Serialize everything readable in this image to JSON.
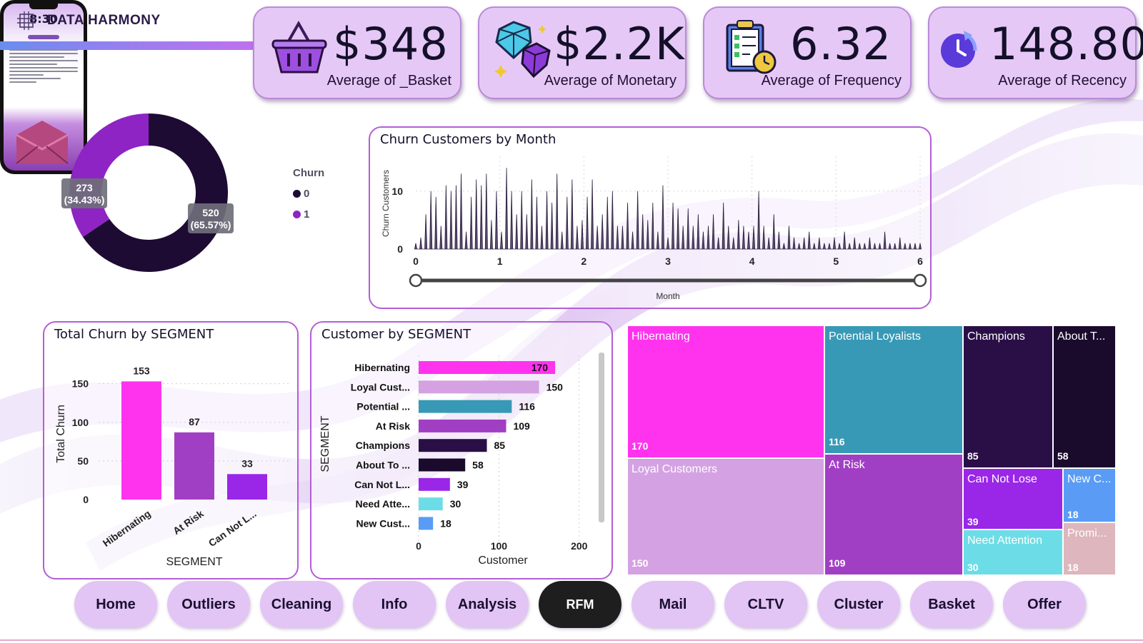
{
  "brand": {
    "name": "DATA HARMONY"
  },
  "kpis": [
    {
      "value": "$348",
      "label": "Average of _Basket",
      "icon": "basket-icon"
    },
    {
      "value": "$2.2K",
      "label": "Average of Monetary",
      "icon": "diamond-icon"
    },
    {
      "value": "6.32",
      "label": "Average of Frequency",
      "icon": "clipboard-clock-icon"
    },
    {
      "value": "148.80",
      "label": "Average of Recency",
      "icon": "refresh-clock-icon"
    }
  ],
  "donut": {
    "legend_title": "Churn",
    "slices": [
      {
        "name": "0",
        "value": 520,
        "label_count": "520",
        "label_pct": "(65.57%)",
        "color": "#1e0b33"
      },
      {
        "name": "1",
        "value": 273,
        "label_count": "273",
        "label_pct": "(34.43%)",
        "color": "#8e24c4"
      }
    ]
  },
  "churn_month": {
    "title": "Churn Customers by Month",
    "ylabel": "Churn Customers",
    "xlabel": "Month",
    "y_ticks": [
      "0",
      "10"
    ],
    "x_ticks": [
      "0",
      "1",
      "2",
      "3",
      "4",
      "5",
      "6"
    ],
    "slider_range": [
      0,
      6
    ]
  },
  "phone": {
    "time": "8:30"
  },
  "churn_segment": {
    "title": "Total Churn by SEGMENT",
    "ylabel": "Total Churn",
    "xlabel": "SEGMENT",
    "y_ticks": [
      "0",
      "50",
      "100",
      "150"
    ]
  },
  "customer_segment": {
    "title": "Customer by SEGMENT",
    "ylabel": "SEGMENT",
    "xlabel": "Customer",
    "x_ticks": [
      "0",
      "100",
      "200"
    ]
  },
  "treemap": {
    "cells": [
      {
        "name": "Hibernating",
        "value": "170",
        "color": "#ff33ee"
      },
      {
        "name": "Potential Loyalists",
        "value": "116",
        "color": "#3799b5"
      },
      {
        "name": "Champions",
        "value": "85",
        "color": "#2a0f47"
      },
      {
        "name": "About T...",
        "value": "58",
        "color": "#1a0a2c"
      },
      {
        "name": "Loyal Customers",
        "value": "150",
        "color": "#d4a2e2"
      },
      {
        "name": "At Risk",
        "value": "109",
        "color": "#a13fc4"
      },
      {
        "name": "Can Not Lose",
        "value": "39",
        "color": "#9a26e8"
      },
      {
        "name": "New C...",
        "value": "18",
        "color": "#5a9cf5"
      },
      {
        "name": "Need Attention",
        "value": "30",
        "color": "#6cdde6"
      },
      {
        "name": "Promi...",
        "value": "18",
        "color": "#deb6bd"
      }
    ]
  },
  "chart_data": [
    {
      "type": "pie",
      "title": "",
      "categories": [
        "0",
        "1"
      ],
      "values": [
        520,
        273
      ],
      "percentages": [
        65.57,
        34.43
      ],
      "legend": "right",
      "legend_title": "Churn"
    },
    {
      "type": "area",
      "title": "Churn Customers by Month",
      "xlabel": "Month",
      "ylabel": "Churn Customers",
      "xlim": [
        0,
        6
      ],
      "ylim": [
        0,
        16
      ],
      "x": [
        0.0,
        0.06,
        0.12,
        0.18,
        0.24,
        0.3,
        0.36,
        0.42,
        0.48,
        0.54,
        0.6,
        0.66,
        0.72,
        0.78,
        0.84,
        0.9,
        0.96,
        1.02,
        1.08,
        1.14,
        1.2,
        1.26,
        1.32,
        1.38,
        1.44,
        1.5,
        1.56,
        1.62,
        1.68,
        1.74,
        1.8,
        1.86,
        1.92,
        1.98,
        2.04,
        2.1,
        2.16,
        2.22,
        2.28,
        2.34,
        2.4,
        2.46,
        2.52,
        2.58,
        2.64,
        2.7,
        2.76,
        2.82,
        2.88,
        2.94,
        3.0,
        3.06,
        3.12,
        3.18,
        3.24,
        3.3,
        3.36,
        3.42,
        3.48,
        3.54,
        3.6,
        3.66,
        3.72,
        3.78,
        3.84,
        3.9,
        3.96,
        4.02,
        4.08,
        4.14,
        4.2,
        4.26,
        4.32,
        4.38,
        4.44,
        4.5,
        4.56,
        4.62,
        4.68,
        4.74,
        4.8,
        4.86,
        4.92,
        4.98,
        5.04,
        5.1,
        5.16,
        5.22,
        5.28,
        5.34,
        5.4,
        5.46,
        5.52,
        5.58,
        5.64,
        5.7,
        5.76,
        5.82,
        5.88,
        5.94,
        6.0
      ],
      "series": [
        {
          "name": "",
          "values": [
            1,
            2,
            6,
            10,
            9,
            4,
            11,
            10,
            11,
            13,
            3,
            9,
            12,
            11,
            13,
            5,
            10,
            3,
            14,
            10,
            6,
            10,
            6,
            12,
            9,
            4,
            10,
            8,
            13,
            3,
            9,
            12,
            4,
            5,
            9,
            12,
            4,
            6,
            9,
            10,
            4,
            4,
            8,
            3,
            10,
            6,
            5,
            8,
            3,
            11,
            2,
            8,
            7,
            4,
            7,
            4,
            6,
            3,
            4,
            6,
            2,
            8,
            4,
            2,
            5,
            4,
            3,
            4,
            10,
            4,
            2,
            6,
            3,
            1,
            4,
            2,
            1,
            2,
            3,
            1,
            2,
            1,
            1,
            2,
            1,
            3,
            1,
            2,
            1,
            1,
            2,
            1,
            1,
            3,
            1,
            1,
            2,
            1,
            1,
            1,
            1
          ]
        }
      ]
    },
    {
      "type": "bar",
      "title": "Total Churn by SEGMENT",
      "xlabel": "SEGMENT",
      "ylabel": "Total Churn",
      "categories": [
        "Hibernating",
        "At Risk",
        "Can Not L..."
      ],
      "values": [
        153,
        87,
        33
      ],
      "colors": [
        "#ff33ee",
        "#a13fc4",
        "#9a26e8"
      ],
      "ylim": [
        0,
        170
      ],
      "grid": true
    },
    {
      "type": "bar",
      "orientation": "horizontal",
      "title": "Customer by SEGMENT",
      "xlabel": "Customer",
      "ylabel": "SEGMENT",
      "categories": [
        "Hibernating",
        "Loyal Cust...",
        "Potential ...",
        "At Risk",
        "Champions",
        "About To ...",
        "Can Not L...",
        "Need Atte...",
        "New Cust..."
      ],
      "values": [
        170,
        150,
        116,
        109,
        85,
        58,
        39,
        30,
        18
      ],
      "colors": [
        "#ff33ee",
        "#d4a2e2",
        "#3799b5",
        "#a13fc4",
        "#2a0f47",
        "#1a0a2c",
        "#9a26e8",
        "#6cdde6",
        "#5a9cf5"
      ],
      "xlim": [
        0,
        210
      ],
      "grid": true
    },
    {
      "type": "treemap",
      "categories": [
        "Hibernating",
        "Potential Loyalists",
        "Champions",
        "About T...",
        "Loyal Customers",
        "At Risk",
        "Can Not Lose",
        "New C...",
        "Need Attention",
        "Promi..."
      ],
      "values": [
        170,
        116,
        85,
        58,
        150,
        109,
        39,
        18,
        30,
        18
      ]
    }
  ],
  "nav": [
    {
      "label": "Home",
      "active": false
    },
    {
      "label": "Outliers",
      "active": false
    },
    {
      "label": "Cleaning",
      "active": false
    },
    {
      "label": "Info",
      "active": false
    },
    {
      "label": "Analysis",
      "active": false
    },
    {
      "label": "RFM",
      "active": true
    },
    {
      "label": "Mail",
      "active": false
    },
    {
      "label": "CLTV",
      "active": false
    },
    {
      "label": "Cluster",
      "active": false
    },
    {
      "label": "Basket",
      "active": false
    },
    {
      "label": "Offer",
      "active": false
    }
  ]
}
